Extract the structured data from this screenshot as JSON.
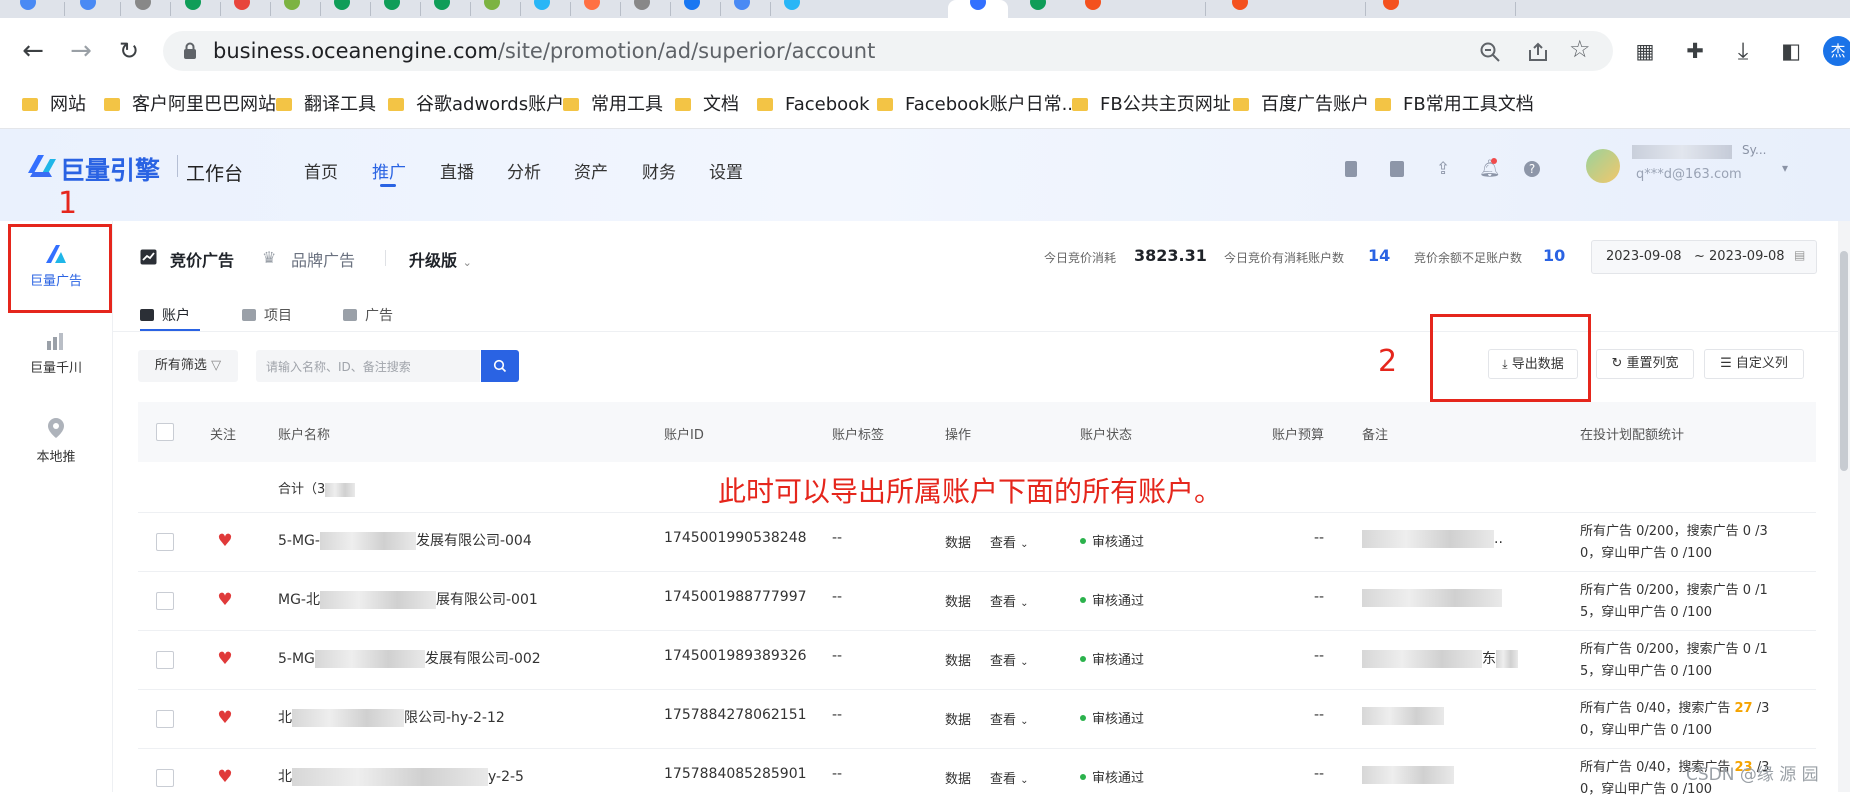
{
  "browser": {
    "url_domain": "business.oceanengine.com",
    "url_path": "/site/promotion/ad/superior/account",
    "profile_initial": "杰"
  },
  "bookmarks": [
    "网站",
    "客户阿里巴巴网站",
    "翻译工具",
    "谷歌adwords账户",
    "常用工具",
    "文档",
    "Facebook",
    "Facebook账户日常...",
    "FB公共主页网址",
    "百度广告账户",
    "FB常用工具文档"
  ],
  "app": {
    "brand": "巨量引擎",
    "workspace": "工作台",
    "nav": [
      "首页",
      "推广",
      "直播",
      "分析",
      "资产",
      "财务",
      "设置"
    ],
    "active_nav": "推广",
    "user_name": "q***d@163.com",
    "user_name_top": "Sy..."
  },
  "rail": [
    {
      "label": "巨量广告",
      "icon": "juliang-ad-icon"
    },
    {
      "label": "巨量千川",
      "icon": "qianchuan-icon"
    },
    {
      "label": "本地推",
      "icon": "local-push-icon"
    }
  ],
  "subnav": {
    "bidding": "竞价广告",
    "brand": "品牌广告",
    "upgrade": "升级版"
  },
  "stats": {
    "today_spend_label": "今日竞价消耗",
    "today_spend_value": "3823.31",
    "accounts_spend_label": "今日竞价有消耗账户数",
    "accounts_spend_value": "14",
    "low_balance_label": "竞价余额不足账户数",
    "low_balance_value": "10",
    "date_start": "2023-09-08",
    "date_end": "~ 2023-09-08"
  },
  "tabs": [
    "账户",
    "项目",
    "广告"
  ],
  "filter": {
    "all_filter": "所有筛选",
    "search_placeholder": "请输入名称、ID、备注搜索"
  },
  "actions": {
    "export": "导出数据",
    "reset_columns": "重置列宽",
    "custom_columns": "自定义列"
  },
  "annotations": {
    "one": "1",
    "two": "2",
    "note": "此时可以导出所属账户下面的所有账户。"
  },
  "table": {
    "headers": [
      "关注",
      "账户名称",
      "账户ID",
      "账户标签",
      "操作",
      "账户状态",
      "账户预算",
      "备注",
      "在投计划配额统计"
    ],
    "total_label": "合计（3",
    "op_data": "数据",
    "op_view": "查看",
    "rows": [
      {
        "name_prefix": "5-MG-",
        "name_suffix": "发展有限公司-004",
        "id": "1745001990538248",
        "tag": "--",
        "status": "审核通过",
        "budget": "--",
        "note_suffix": "..",
        "quota_line1": "所有广告 0/200，搜索广告 0 /3",
        "quota_line2": "0，穿山甲广告 0 /100",
        "highlight": ""
      },
      {
        "name_prefix": "MG-北",
        "name_suffix": "展有限公司-001",
        "id": "1745001988777997",
        "tag": "--",
        "status": "审核通过",
        "budget": "--",
        "note_suffix": "",
        "quota_line1": "所有广告 0/200，搜索广告 0 /1",
        "quota_line2": "5，穿山甲广告 0 /100",
        "highlight": ""
      },
      {
        "name_prefix": "5-MG",
        "name_suffix": "发展有限公司-002",
        "id": "1745001989389326",
        "tag": "--",
        "status": "审核通过",
        "budget": "--",
        "note_suffix": "东",
        "quota_line1": "所有广告 0/200，搜索广告 0 /1",
        "quota_line2": "5，穿山甲广告 0 /100",
        "highlight": ""
      },
      {
        "name_prefix": "北",
        "name_suffix": "限公司-hy-2-12",
        "id": "1757884278062151",
        "tag": "--",
        "status": "审核通过",
        "budget": "--",
        "note_suffix": "",
        "quota_line1": "所有广告 0/40，搜索广告",
        "quota_line1_hl": "27",
        "quota_line1_end": "/3",
        "quota_line2": "0，穿山甲广告 0 /100",
        "highlight": "27"
      },
      {
        "name_prefix": "北",
        "name_suffix": "y-2-5",
        "id": "1757884085285901",
        "tag": "--",
        "status": "审核通过",
        "budget": "--",
        "note_suffix": "",
        "quota_line1": "所有广告 0/40，搜索广告",
        "quota_line1_hl": "23",
        "quota_line1_end": "/3",
        "quota_line2": "0，穿山甲广告 0 /100",
        "highlight": "23"
      }
    ]
  },
  "watermark": "CSDN @缘 源 园",
  "colors": {
    "brand_blue": "#3370ff",
    "annotation_red": "#e5261c",
    "heart": "#e03a3a",
    "status_green": "#2bb24c"
  }
}
